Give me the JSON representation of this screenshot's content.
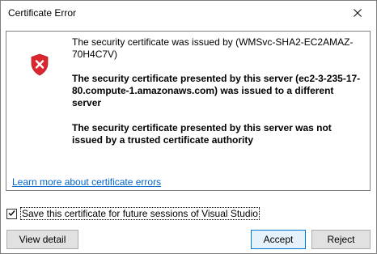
{
  "window": {
    "title": "Certificate Error"
  },
  "message": {
    "issued_by": "The security certificate was issued by (WMSvc-SHA2-EC2AMAZ-70H4C7V)",
    "error_different_server": "The security certificate presented by this server (ec2-3-235-17-80.compute-1.amazonaws.com) was issued to a different server",
    "error_untrusted_authority": "The security certificate presented by this server was not issued by a trusted certificate authority",
    "learn_more_link": "Learn more about certificate errors"
  },
  "save_option": {
    "label": "Save this certificate for future sessions of Visual Studio",
    "checked": true
  },
  "buttons": {
    "view_detail": "View detail",
    "accept": "Accept",
    "reject": "Reject"
  },
  "icons": {
    "close": "close-icon",
    "error_shield": "shield-error-icon",
    "checkmark": "checkmark-icon"
  },
  "colors": {
    "shield_red": "#d9262f",
    "link_blue": "#0066cc",
    "accent_border": "#0078d7"
  }
}
